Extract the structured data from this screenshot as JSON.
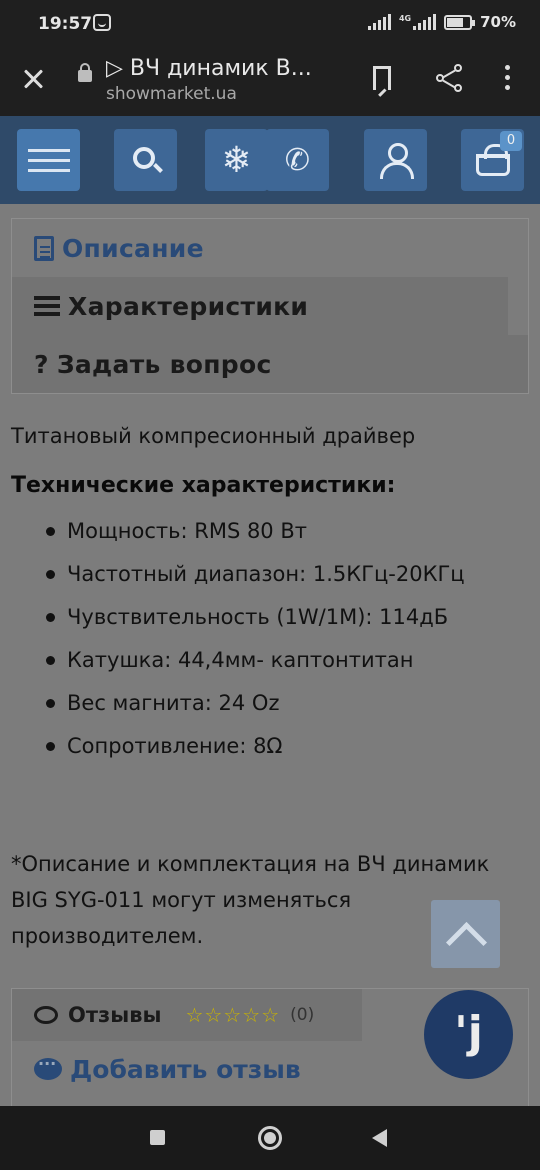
{
  "status_bar": {
    "time": "19:57",
    "network": "4G",
    "battery": "70%"
  },
  "browser": {
    "title": "▷ ВЧ динамик B...",
    "url": "showmarket.ua"
  },
  "header": {
    "cart_count": "0",
    "snow_glyph": "❄",
    "phone_glyph": "✆"
  },
  "tabs": {
    "description": "Описание",
    "specs": "Характеристики",
    "ask": "Задать вопрос",
    "ask_glyph": "?"
  },
  "description": {
    "intro": "Титановый компресионный драйвер",
    "spec_heading": "Технические характеристики:",
    "specs": [
      "Мощность: RMS 80 Вт",
      "Частотный диапазон: 1.5КГц-20КГц",
      "Чувствительность (1W/1M): 114дБ",
      "Катушка: 44,4мм- каптонтитан",
      "Вес магнита: 24 Oz",
      "Сопротивление: 8Ω"
    ],
    "note": "*Описание и комплектация на ВЧ динамик BIG SYG-011 могут изменяться производителем."
  },
  "reviews": {
    "tab_label": "Отзывы",
    "stars": "☆☆☆☆☆",
    "count": "(0)",
    "add_review": "Добавить отзыв"
  },
  "chat": {
    "glyph": "ꞌj"
  },
  "colors": {
    "header_bg": "#2f4a69",
    "button_bg": "#3e6796",
    "link": "#294a78",
    "content_bg": "#7c7c7c"
  }
}
